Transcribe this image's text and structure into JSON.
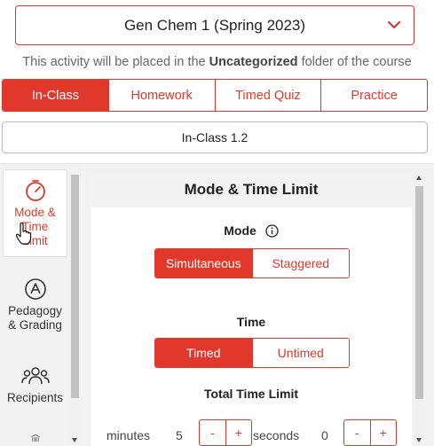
{
  "course_select": {
    "value": "Gen Chem 1 (Spring 2023)",
    "icon": "chevron-down-icon"
  },
  "info": {
    "prefix": "This activity will be placed in the ",
    "folder": "Uncategorized",
    "suffix": " folder of the course"
  },
  "activity_types": [
    {
      "label": "In-Class",
      "active": true
    },
    {
      "label": "Homework",
      "active": false
    },
    {
      "label": "Timed Quiz",
      "active": false
    },
    {
      "label": "Practice",
      "active": false
    }
  ],
  "activity_name": "In-Class 1.2",
  "side_nav": {
    "items": [
      {
        "label_lines": [
          "Mode &",
          "Time",
          "Limit"
        ],
        "icon": "stopwatch-icon",
        "active": true
      },
      {
        "label_lines": [
          "Pedagogy",
          "& Grading"
        ],
        "icon": "pedagogy-icon",
        "active": false
      },
      {
        "label_lines": [
          "Recipients"
        ],
        "icon": "recipients-icon",
        "active": false
      },
      {
        "label_lines": [],
        "icon": "building-icon",
        "active": false
      }
    ]
  },
  "panel": {
    "title": "Mode & Time Limit",
    "mode": {
      "label": "Mode",
      "options": [
        "Simultaneous",
        "Staggered"
      ],
      "selected": "Simultaneous"
    },
    "time": {
      "label": "Time",
      "options": [
        "Timed",
        "Untimed"
      ],
      "selected": "Timed"
    },
    "total_time_limit": {
      "label": "Total Time Limit",
      "minutes_label": "minutes",
      "minutes_value": "5",
      "seconds_label": "seconds",
      "seconds_value": "0",
      "decrement": "-",
      "increment": "+"
    }
  },
  "colors": {
    "accent": "#e0392b"
  }
}
